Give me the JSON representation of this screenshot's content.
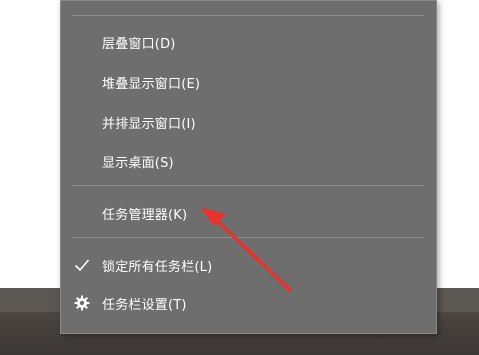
{
  "menu": {
    "items": [
      {
        "label": "层叠窗口(D)"
      },
      {
        "label": "堆叠显示窗口(E)"
      },
      {
        "label": "并排显示窗口(I)"
      },
      {
        "label": "显示桌面(S)"
      },
      {
        "label": "任务管理器(K)"
      },
      {
        "label": "锁定所有任务栏(L)",
        "checked": true,
        "icon": "checkmark-icon"
      },
      {
        "label": "任务栏设置(T)",
        "icon": "gear-icon"
      }
    ]
  },
  "colors": {
    "menu_background": "#6e6e6e",
    "menu_text": "#ffffff",
    "separator": "#8f8f8f",
    "annotation_arrow": "#e8322b"
  }
}
